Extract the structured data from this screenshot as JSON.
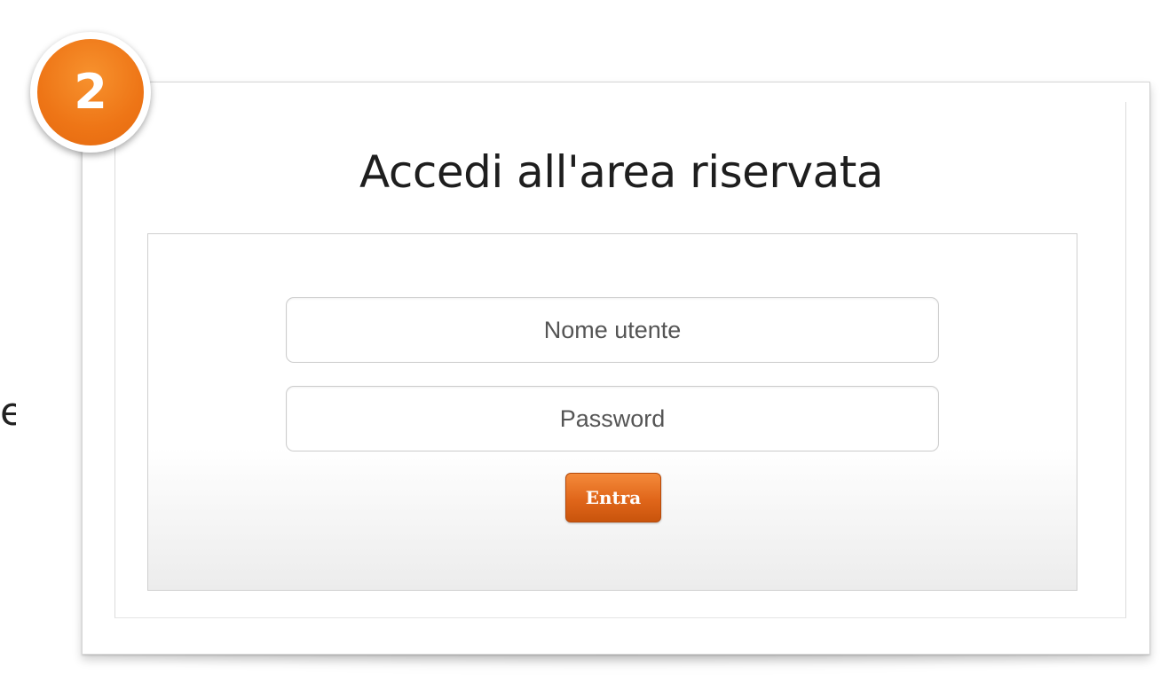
{
  "step_badge": {
    "number": "2",
    "color": "#ee7516"
  },
  "partial_text": "e",
  "login": {
    "title": "Accedi all'area riservata",
    "username_placeholder": "Nome utente",
    "password_placeholder": "Password",
    "submit_label": "Entra",
    "button_color": "#e0661a"
  }
}
